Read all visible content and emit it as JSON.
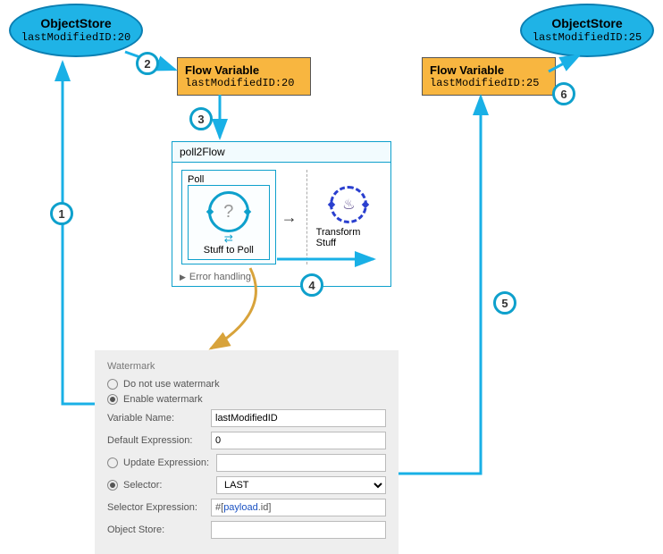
{
  "objectStoreLeft": {
    "title": "ObjectStore",
    "value": "lastModifiedID:20"
  },
  "objectStoreRight": {
    "title": "ObjectStore",
    "value": "lastModifiedID:25"
  },
  "flowVarLeft": {
    "title": "Flow Variable",
    "value": "lastModifiedID:20"
  },
  "flowVarRight": {
    "title": "Flow Variable",
    "value": "lastModifiedID:25"
  },
  "pollFlow": {
    "title": "poll2Flow",
    "pollBox": "Poll",
    "stuffToPoll": "Stuff to Poll",
    "transform": "Transform Stuff",
    "errorHandling": "Error handling",
    "qmark": "?"
  },
  "watermark": {
    "sectionTitle": "Watermark",
    "noWatermark": "Do not use watermark",
    "enable": "Enable watermark",
    "varNameLabel": "Variable Name:",
    "varNameValue": "lastModifiedID",
    "defaultExprLabel": "Default Expression:",
    "defaultExprValue": "0",
    "updateExprLabel": "Update Expression:",
    "updateExprValue": "",
    "selectorLabel": "Selector:",
    "selectorValue": "LAST",
    "selectorExprLabel": "Selector Expression:",
    "selectorExprPrefix": "#[",
    "selectorExprPayload": "payload",
    "selectorExprSuffix": ".id]",
    "objectStoreLabel": "Object Store:",
    "objectStoreValue": ""
  },
  "steps": [
    "1",
    "2",
    "3",
    "4",
    "5",
    "6"
  ]
}
